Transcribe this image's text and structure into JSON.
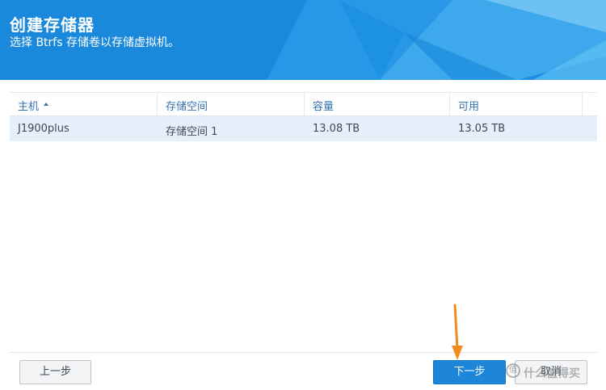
{
  "header": {
    "title": "创建存储器",
    "subtitle": "选择 Btrfs 存储卷以存储虚拟机。",
    "bg_color": "#1f8ee0"
  },
  "table": {
    "columns": [
      {
        "label": "主机",
        "sorted": "ascending"
      },
      {
        "label": "存储空间"
      },
      {
        "label": "容量"
      },
      {
        "label": "可用"
      }
    ],
    "rows": [
      {
        "host": "J1900plus",
        "storage": "存储空间 1",
        "capacity": "13.08 TB",
        "available": "13.05 TB",
        "selected": true
      }
    ],
    "selected_row_color": "#e6f0fb"
  },
  "footer": {
    "prev_label": "上一步",
    "next_label": "下一步",
    "cancel_label": "取消",
    "next_color": "#1d86d8"
  },
  "annotation": {
    "arrow_color": "#f08b1f"
  },
  "watermark": {
    "text": "什么值得买",
    "icon_glyph": "值"
  }
}
